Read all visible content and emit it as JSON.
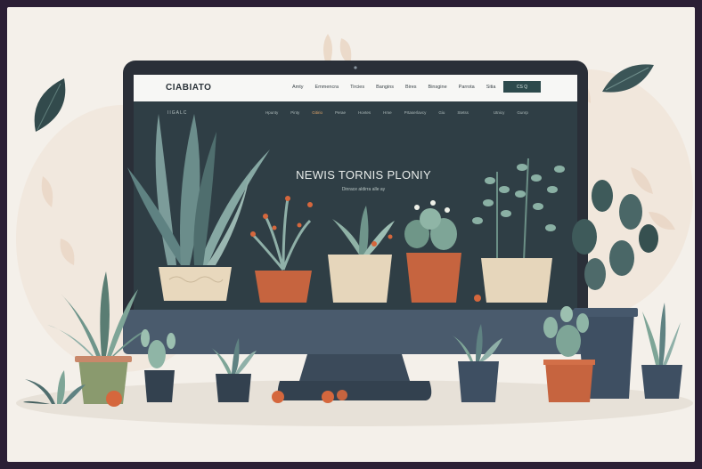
{
  "site": {
    "logo": "CIABIATO",
    "nav_links": [
      "Amty",
      "Emmencra",
      "Tircies",
      "Bangins",
      "Bires",
      "Binsgine",
      "Parrota",
      "Sitia"
    ],
    "nav_button": "CS Q"
  },
  "subnav": {
    "logo": "IIGALC",
    "links": [
      "Hpunty",
      "Pinty",
      "Gitirio",
      "Perae",
      "Hovtes",
      "Hme",
      "Prtaserlavcy",
      "Giu",
      "Stetss",
      "",
      "Utnicy",
      "Gunrp"
    ]
  },
  "hero": {
    "title": "NEWIS TORNIS PLONIY",
    "subtitle": "Dinrace aldirra alle ay"
  },
  "colors": {
    "screen": "#2f3e45",
    "bezel": "#2a2f38",
    "stand": "#3d4b5a",
    "terracotta": "#c7633f",
    "leaf_dark": "#3e5a5a",
    "leaf_light": "#7ea597",
    "cream_pot": "#e6d6bb",
    "background": "#f4f0ea"
  }
}
